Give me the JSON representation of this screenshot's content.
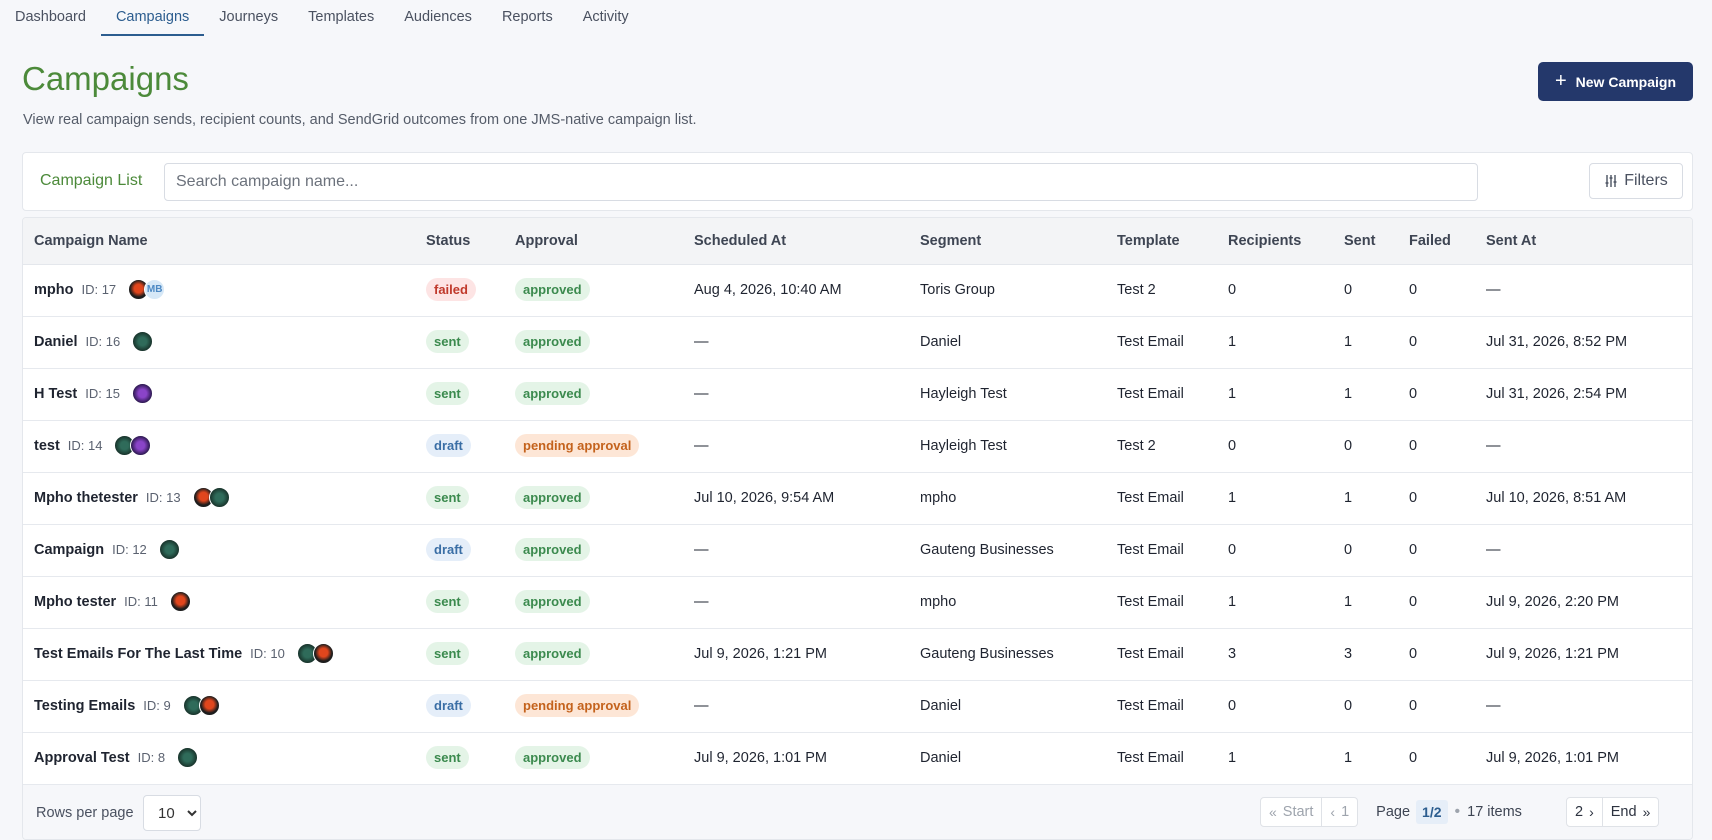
{
  "nav": {
    "tabs": [
      "Dashboard",
      "Campaigns",
      "Journeys",
      "Templates",
      "Audiences",
      "Reports",
      "Activity"
    ],
    "active": "Campaigns"
  },
  "header": {
    "title": "Campaigns",
    "subtitle": "View real campaign sends, recipient counts, and SendGrid outcomes from one JMS-native campaign list.",
    "new_button": "New Campaign"
  },
  "list": {
    "label": "Campaign List",
    "search_placeholder": "Search campaign name...",
    "filters_label": "Filters"
  },
  "table": {
    "columns": [
      "Campaign Name",
      "Status",
      "Approval",
      "Scheduled At",
      "Segment",
      "Template",
      "Recipients",
      "Sent",
      "Failed",
      "Sent At"
    ],
    "rows": [
      {
        "name": "mpho",
        "id": "ID: 17",
        "avatars": [
          "red",
          "mb"
        ],
        "status": "failed",
        "approval": "approved",
        "scheduled": "Aug 4, 2026, 10:40 AM",
        "segment": "Toris Group",
        "template": "Test 2",
        "recipients": "0",
        "sent": "0",
        "failed": "0",
        "sent_at": "—"
      },
      {
        "name": "Daniel",
        "id": "ID: 16",
        "avatars": [
          "green"
        ],
        "status": "sent",
        "approval": "approved",
        "scheduled": "—",
        "segment": "Daniel",
        "template": "Test Email",
        "recipients": "1",
        "sent": "1",
        "failed": "0",
        "sent_at": "Jul 31, 2026, 8:52 PM"
      },
      {
        "name": "H Test",
        "id": "ID: 15",
        "avatars": [
          "purple"
        ],
        "status": "sent",
        "approval": "approved",
        "scheduled": "—",
        "segment": "Hayleigh Test",
        "template": "Test Email",
        "recipients": "1",
        "sent": "1",
        "failed": "0",
        "sent_at": "Jul 31, 2026, 2:54 PM"
      },
      {
        "name": "test",
        "id": "ID: 14",
        "avatars": [
          "green",
          "purple"
        ],
        "status": "draft",
        "approval": "pending approval",
        "scheduled": "—",
        "segment": "Hayleigh Test",
        "template": "Test 2",
        "recipients": "0",
        "sent": "0",
        "failed": "0",
        "sent_at": "—"
      },
      {
        "name": "Mpho thetester",
        "id": "ID: 13",
        "avatars": [
          "red",
          "green"
        ],
        "status": "sent",
        "approval": "approved",
        "scheduled": "Jul 10, 2026, 9:54 AM",
        "segment": "mpho",
        "template": "Test Email",
        "recipients": "1",
        "sent": "1",
        "failed": "0",
        "sent_at": "Jul 10, 2026, 8:51 AM"
      },
      {
        "name": "Campaign",
        "id": "ID: 12",
        "avatars": [
          "green"
        ],
        "status": "draft",
        "approval": "approved",
        "scheduled": "—",
        "segment": "Gauteng Businesses",
        "template": "Test Email",
        "recipients": "0",
        "sent": "0",
        "failed": "0",
        "sent_at": "—"
      },
      {
        "name": "Mpho tester",
        "id": "ID: 11",
        "avatars": [
          "red"
        ],
        "status": "sent",
        "approval": "approved",
        "scheduled": "—",
        "segment": "mpho",
        "template": "Test Email",
        "recipients": "1",
        "sent": "1",
        "failed": "0",
        "sent_at": "Jul 9, 2026, 2:20 PM"
      },
      {
        "name": "Test Emails For The Last Time",
        "id": "ID: 10",
        "avatars": [
          "green",
          "red"
        ],
        "status": "sent",
        "approval": "approved",
        "scheduled": "Jul 9, 2026, 1:21 PM",
        "segment": "Gauteng Businesses",
        "template": "Test Email",
        "recipients": "3",
        "sent": "3",
        "failed": "0",
        "sent_at": "Jul 9, 2026, 1:21 PM"
      },
      {
        "name": "Testing Emails",
        "id": "ID: 9",
        "avatars": [
          "green",
          "red"
        ],
        "status": "draft",
        "approval": "pending approval",
        "scheduled": "—",
        "segment": "Daniel",
        "template": "Test Email",
        "recipients": "0",
        "sent": "0",
        "failed": "0",
        "sent_at": "—"
      },
      {
        "name": "Approval Test",
        "id": "ID: 8",
        "avatars": [
          "green"
        ],
        "status": "sent",
        "approval": "approved",
        "scheduled": "Jul 9, 2026, 1:01 PM",
        "segment": "Daniel",
        "template": "Test Email",
        "recipients": "1",
        "sent": "1",
        "failed": "0",
        "sent_at": "Jul 9, 2026, 1:01 PM"
      }
    ]
  },
  "footer": {
    "rows_per_page_label": "Rows per page",
    "rows_per_page_value": "10",
    "start_label": "Start",
    "prev_page": "1",
    "page_label": "Page",
    "page_indicator": "1/2",
    "items_label": "17 items",
    "next_page": "2",
    "end_label": "End"
  },
  "colors": {
    "accent_green": "#4c8a3a",
    "primary_button": "#24386b",
    "active_tab": "#2c5d8f"
  }
}
